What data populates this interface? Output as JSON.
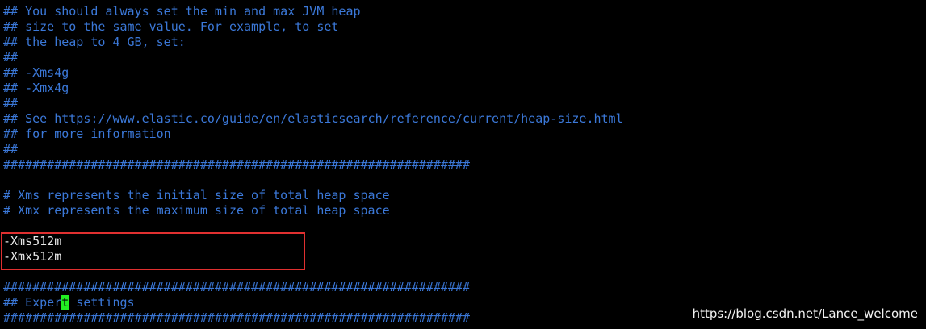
{
  "terminal": {
    "lines": [
      "## You should always set the min and max JVM heap",
      "## size to the same value. For example, to set",
      "## the heap to 4 GB, set:",
      "##",
      "## -Xms4g",
      "## -Xmx4g",
      "##",
      "## See https://www.elastic.co/guide/en/elasticsearch/reference/current/heap-size.html",
      "## for more information",
      "##",
      "################################################################",
      "",
      "# Xms represents the initial size of total heap space",
      "# Xmx represents the maximum size of total heap space",
      "",
      "-Xms512m",
      "-Xmx512m",
      "",
      "################################################################",
      "## Expert settings",
      "################################################################"
    ],
    "cursor_line": {
      "before": "## Exper",
      "cursor_char": "t",
      "after": " settings"
    }
  },
  "watermark": "https://blog.csdn.net/Lance_welcome",
  "colors": {
    "background": "#000000",
    "comment": "#3b78d8",
    "config": "#e8e8e8",
    "cursor": "#22ee22",
    "highlight_border": "#e03030"
  }
}
